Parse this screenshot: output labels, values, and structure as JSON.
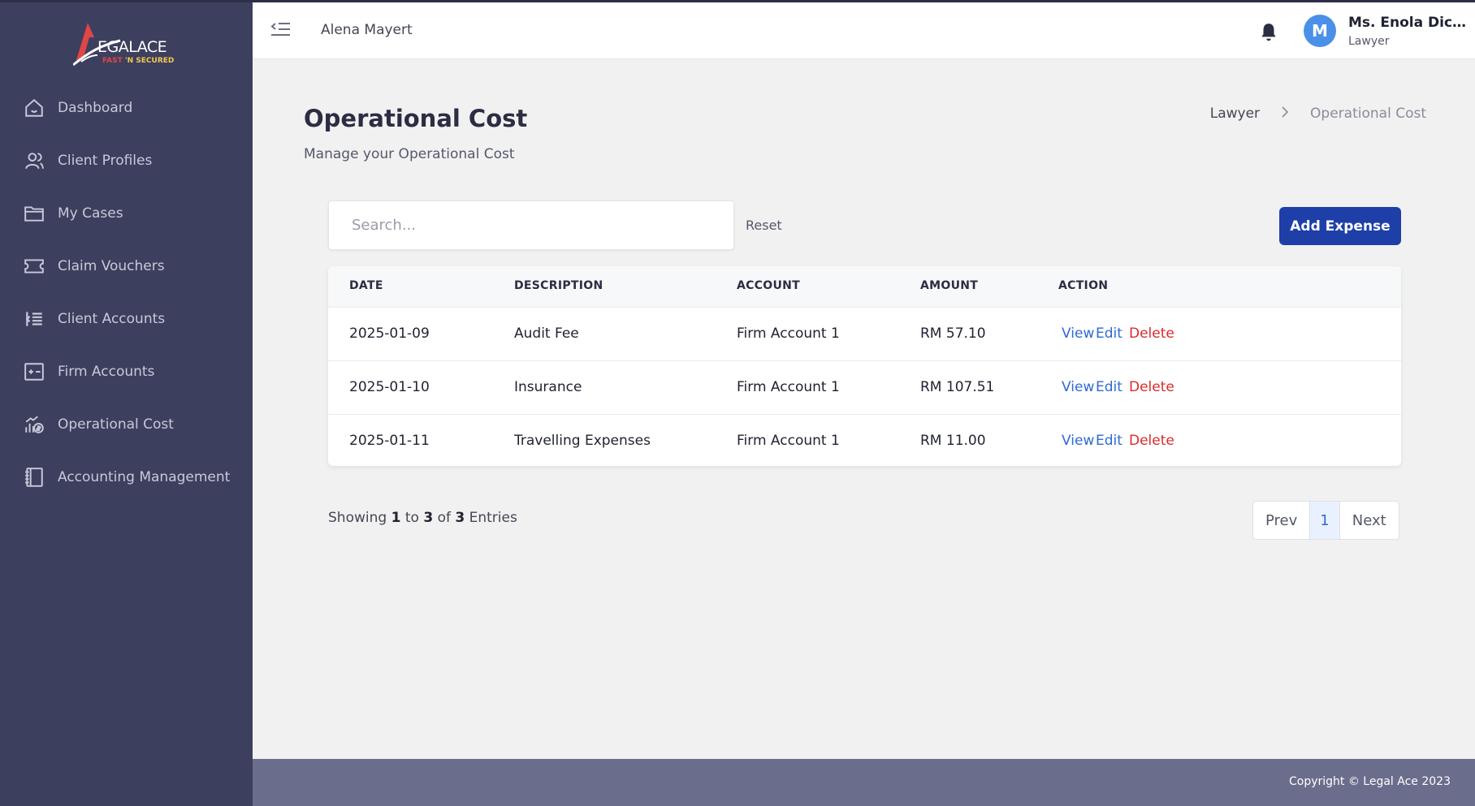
{
  "brand": {
    "logo_text": "EGALACE",
    "tagline_a": "FAST",
    "tagline_b": "'N",
    "tagline_c": "SECURED"
  },
  "sidebar": {
    "items": [
      {
        "label": "Dashboard",
        "icon": "home-icon"
      },
      {
        "label": "Client Profiles",
        "icon": "users-icon"
      },
      {
        "label": "My Cases",
        "icon": "folder-icon"
      },
      {
        "label": "Claim Vouchers",
        "icon": "ticket-icon"
      },
      {
        "label": "Client Accounts",
        "icon": "list-indent-icon"
      },
      {
        "label": "Firm Accounts",
        "icon": "plus-minus-icon"
      },
      {
        "label": "Operational Cost",
        "icon": "cost-chart-icon"
      },
      {
        "label": "Accounting Management",
        "icon": "notebook-icon"
      }
    ]
  },
  "header": {
    "name": "Alena Mayert",
    "user_name": "Ms. Enola Dickinson",
    "user_role": "Lawyer",
    "avatar_letter": "M"
  },
  "page": {
    "title": "Operational Cost",
    "subtitle": "Manage your Operational Cost",
    "breadcrumb": [
      "Lawyer",
      "Operational Cost"
    ]
  },
  "toolbar": {
    "search_placeholder": "Search...",
    "reset_label": "Reset",
    "add_label": "Add Expense"
  },
  "table": {
    "columns": [
      "DATE",
      "DESCRIPTION",
      "ACCOUNT",
      "AMOUNT",
      "ACTION"
    ],
    "rows": [
      {
        "date": "2025-01-09",
        "description": "Audit Fee",
        "account": "Firm Account 1",
        "amount": "RM 57.10"
      },
      {
        "date": "2025-01-10",
        "description": "Insurance",
        "account": "Firm Account 1",
        "amount": "RM 107.51"
      },
      {
        "date": "2025-01-11",
        "description": "Travelling Expenses",
        "account": "Firm Account 1",
        "amount": "RM 11.00"
      }
    ],
    "actions": {
      "view": "View",
      "edit": "Edit",
      "delete": "Delete"
    }
  },
  "pagination": {
    "showing_prefix": "Showing",
    "from": "1",
    "to_word": "to",
    "to": "3",
    "of_word": "of",
    "total": "3",
    "suffix": "Entries",
    "prev": "Prev",
    "current": "1",
    "next": "Next"
  },
  "footer": {
    "copyright": "Copyright © Legal Ace 2023"
  },
  "colors": {
    "sidebar_bg": "#3d3f5e",
    "primary_button": "#1e3fa8",
    "link_blue": "#2f6ad6",
    "delete_red": "#d92b2b",
    "footer_bg": "#6b6d8c",
    "avatar_bg": "#4a90e8"
  }
}
